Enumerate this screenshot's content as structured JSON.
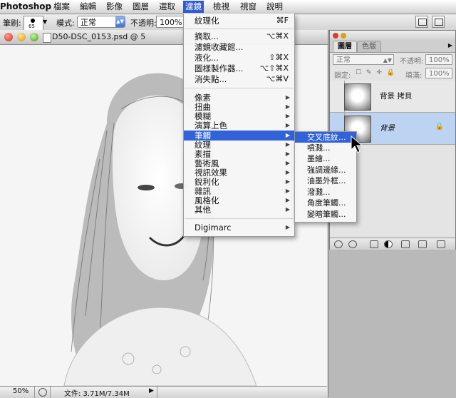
{
  "menubar": {
    "app": "Photoshop",
    "items": [
      "檔案",
      "編輯",
      "影像",
      "圖層",
      "選取",
      "濾鏡",
      "檢視",
      "視窗",
      "說明"
    ],
    "active_index": 5
  },
  "options": {
    "brush_label": "筆刷:",
    "brush_size": "65",
    "mode_label": "模式:",
    "mode_value": "正常",
    "opacity_label": "不透明:",
    "opacity_value": "100%"
  },
  "document": {
    "title": "D50-DSC_0153.psd @ 5",
    "zoom": "50%",
    "file_info": "文件: 3.71M/7.34M"
  },
  "layers_panel": {
    "tabs": [
      "圖層",
      "色版"
    ],
    "blend_mode": "正常",
    "opacity_label": "不透明:",
    "opacity_value": "100%",
    "lock_label": "鎖定:",
    "fill_label": "填滿:",
    "fill_value": "100%",
    "layers": [
      {
        "name": "背景 拷貝",
        "selected": false,
        "locked": false
      },
      {
        "name": "背景",
        "selected": true,
        "locked": true
      }
    ]
  },
  "filter_menu": {
    "items": [
      {
        "label": "紋理化",
        "shortcut": "⌘F",
        "submenu": false
      },
      {
        "label": "---"
      },
      {
        "label": "摘取...",
        "shortcut": "⌥⌘X",
        "submenu": false
      },
      {
        "label": "濾鏡收藏館...",
        "shortcut": "",
        "submenu": false
      },
      {
        "label": "液化...",
        "shortcut": "⇧⌘X",
        "submenu": false
      },
      {
        "label": "圖樣製作器...",
        "shortcut": "⌥⇧⌘X",
        "submenu": false
      },
      {
        "label": "消失點...",
        "shortcut": "⌥⌘V",
        "submenu": false
      },
      {
        "label": "---"
      },
      {
        "label": "像素",
        "shortcut": "",
        "submenu": true
      },
      {
        "label": "扭曲",
        "shortcut": "",
        "submenu": true
      },
      {
        "label": "模糊",
        "shortcut": "",
        "submenu": true
      },
      {
        "label": "演算上色",
        "shortcut": "",
        "submenu": true
      },
      {
        "label": "筆觸",
        "shortcut": "",
        "submenu": true,
        "highlighted": true
      },
      {
        "label": "紋理",
        "shortcut": "",
        "submenu": true
      },
      {
        "label": "素描",
        "shortcut": "",
        "submenu": true
      },
      {
        "label": "藝術風",
        "shortcut": "",
        "submenu": true
      },
      {
        "label": "視訊效果",
        "shortcut": "",
        "submenu": true
      },
      {
        "label": "銳利化",
        "shortcut": "",
        "submenu": true
      },
      {
        "label": "雜訊",
        "shortcut": "",
        "submenu": true
      },
      {
        "label": "風格化",
        "shortcut": "",
        "submenu": true
      },
      {
        "label": "其他",
        "shortcut": "",
        "submenu": true
      },
      {
        "label": "---"
      },
      {
        "label": "Digimarc",
        "shortcut": "",
        "submenu": true
      }
    ]
  },
  "submenu": {
    "items": [
      "交叉底紋...",
      "噴濺...",
      "墨繪...",
      "強調邊緣...",
      "油墨外框...",
      "潑濺...",
      "角度筆觸...",
      "變暗筆觸..."
    ],
    "highlighted_index": 0
  },
  "colors": {
    "highlight": "#3162d9",
    "layer_selected": "#bcd4f2"
  }
}
